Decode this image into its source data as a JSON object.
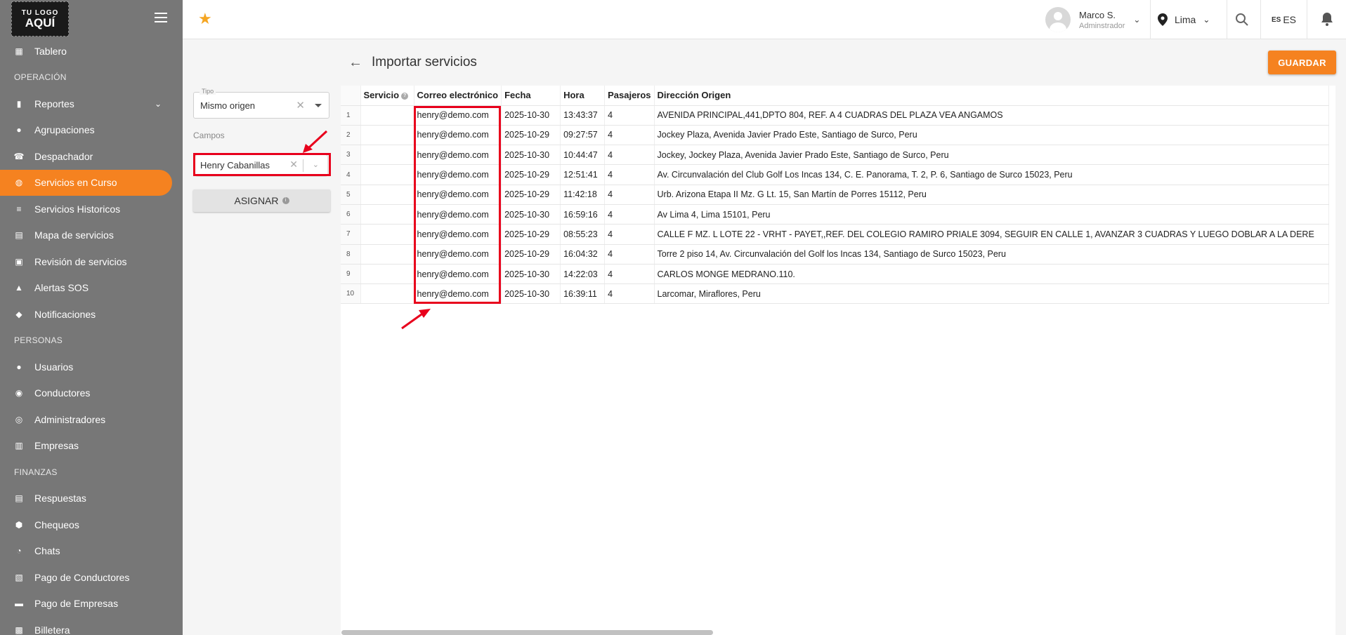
{
  "sidebar": {
    "logo": {
      "line1": "TU LOGO",
      "line2": "AQUÍ"
    },
    "items": [
      {
        "type": "item",
        "label": "Tablero",
        "icon": "dashboard-icon"
      },
      {
        "type": "section",
        "label": "OPERACIÓN"
      },
      {
        "type": "item",
        "label": "Reportes",
        "icon": "bar-chart-icon",
        "expandable": true
      },
      {
        "type": "item",
        "label": "Agrupaciones",
        "icon": "group-circle-icon"
      },
      {
        "type": "item",
        "label": "Despachador",
        "icon": "phone-icon"
      },
      {
        "type": "item",
        "label": "Servicios en Curso",
        "icon": "globe-icon",
        "active": true
      },
      {
        "type": "item",
        "label": "Servicios Historicos",
        "icon": "list-icon"
      },
      {
        "type": "item",
        "label": "Mapa de servicios",
        "icon": "map-icon"
      },
      {
        "type": "item",
        "label": "Revisión de servicios",
        "icon": "review-icon"
      },
      {
        "type": "item",
        "label": "Alertas SOS",
        "icon": "warning-icon"
      },
      {
        "type": "item",
        "label": "Notificaciones",
        "icon": "bell-icon"
      },
      {
        "type": "section",
        "label": "PERSONAS"
      },
      {
        "type": "item",
        "label": "Usuarios",
        "icon": "users-icon"
      },
      {
        "type": "item",
        "label": "Conductores",
        "icon": "steering-wheel-icon"
      },
      {
        "type": "item",
        "label": "Administradores",
        "icon": "admin-icon"
      },
      {
        "type": "item",
        "label": "Empresas",
        "icon": "building-icon"
      },
      {
        "type": "section",
        "label": "FINANZAS"
      },
      {
        "type": "item",
        "label": "Respuestas",
        "icon": "answers-icon"
      },
      {
        "type": "item",
        "label": "Chequeos",
        "icon": "shield-check-icon"
      },
      {
        "type": "item",
        "label": "Chats",
        "icon": "chat-icon"
      },
      {
        "type": "item",
        "label": "Pago de Conductores",
        "icon": "receipt-icon"
      },
      {
        "type": "item",
        "label": "Pago de Empresas",
        "icon": "card-icon"
      },
      {
        "type": "item",
        "label": "Billetera",
        "icon": "wallet-icon"
      }
    ]
  },
  "header": {
    "user_name": "Marco S.",
    "user_role": "Adminstrador",
    "city": "Lima",
    "lang_code": "ES",
    "lang_label": "ES",
    "accent": "#f58220"
  },
  "panel": {
    "tipo_label": "Tipo",
    "tipo_value": "Mismo origen",
    "campos_label": "Campos",
    "campos_value": "Henry Cabanillas",
    "asignar_label": "ASIGNAR"
  },
  "main": {
    "title": "Importar servicios",
    "save_label": "GUARDAR"
  },
  "table": {
    "headers": [
      "Servicio",
      "Correo electrónico",
      "Fecha",
      "Hora",
      "Pasajeros",
      "Dirección Origen"
    ],
    "rows": [
      {
        "n": "1",
        "servicio": "",
        "email": "henry@demo.com",
        "fecha": "2025-10-30",
        "hora": "13:43:37",
        "pasajeros": "4",
        "direccion": "AVENIDA PRINCIPAL,441,DPTO 804, REF. A 4 CUADRAS DEL PLAZA VEA ANGAMOS"
      },
      {
        "n": "2",
        "servicio": "",
        "email": "henry@demo.com",
        "fecha": "2025-10-29",
        "hora": "09:27:57",
        "pasajeros": "4",
        "direccion": "Jockey Plaza, Avenida Javier Prado Este, Santiago de Surco, Peru"
      },
      {
        "n": "3",
        "servicio": "",
        "email": "henry@demo.com",
        "fecha": "2025-10-30",
        "hora": "10:44:47",
        "pasajeros": "4",
        "direccion": "Jockey, Jockey Plaza, Avenida Javier Prado Este, Santiago de Surco, Peru"
      },
      {
        "n": "4",
        "servicio": "",
        "email": "henry@demo.com",
        "fecha": "2025-10-29",
        "hora": "12:51:41",
        "pasajeros": "4",
        "direccion": "Av. Circunvalación del Club Golf Los Incas 134, C. E. Panorama, T. 2, P. 6, Santiago de Surco 15023, Peru"
      },
      {
        "n": "5",
        "servicio": "",
        "email": "henry@demo.com",
        "fecha": "2025-10-29",
        "hora": "11:42:18",
        "pasajeros": "4",
        "direccion": "Urb. Arizona Etapa II Mz. G Lt. 15, San Martín de Porres 15112, Peru"
      },
      {
        "n": "6",
        "servicio": "",
        "email": "henry@demo.com",
        "fecha": "2025-10-30",
        "hora": "16:59:16",
        "pasajeros": "4",
        "direccion": "Av Lima 4, Lima 15101, Peru"
      },
      {
        "n": "7",
        "servicio": "",
        "email": "henry@demo.com",
        "fecha": "2025-10-29",
        "hora": "08:55:23",
        "pasajeros": "4",
        "direccion": "CALLE F MZ. L LOTE 22 - VRHT - PAYET,,REF. DEL COLEGIO RAMIRO PRIALE 3094, SEGUIR EN CALLE 1, AVANZAR 3 CUADRAS Y LUEGO DOBLAR A LA DERE"
      },
      {
        "n": "8",
        "servicio": "",
        "email": "henry@demo.com",
        "fecha": "2025-10-29",
        "hora": "16:04:32",
        "pasajeros": "4",
        "direccion": "Torre 2 piso 14, Av. Circunvalación del Golf los Incas 134, Santiago de Surco 15023, Peru"
      },
      {
        "n": "9",
        "servicio": "",
        "email": "henry@demo.com",
        "fecha": "2025-10-30",
        "hora": "14:22:03",
        "pasajeros": "4",
        "direccion": "CARLOS MONGE MEDRANO.110."
      },
      {
        "n": "10",
        "servicio": "",
        "email": "henry@demo.com",
        "fecha": "2025-10-30",
        "hora": "16:39:11",
        "pasajeros": "4",
        "direccion": "Larcomar, Miraflores, Peru"
      }
    ]
  },
  "annotations": {
    "highlight_color": "#e8001c"
  }
}
